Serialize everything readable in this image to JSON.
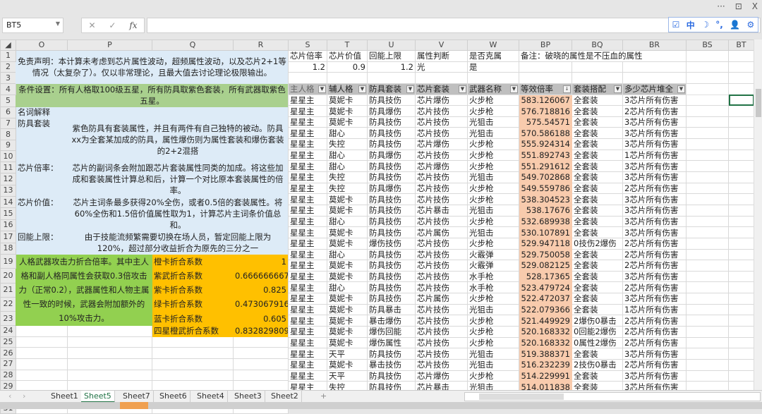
{
  "window": {
    "more": "···",
    "restore": "⊡",
    "close": "X"
  },
  "formula_bar": {
    "name_box": "BT5",
    "cancel": "✕",
    "confirm": "✓",
    "fx": "fx",
    "value": "",
    "ime_icons": [
      "☑",
      "中",
      "☽",
      "°,",
      "👤",
      "⚙"
    ]
  },
  "columns": [
    "O",
    "P",
    "Q",
    "R",
    "S",
    "T",
    "U",
    "V",
    "W",
    "BP",
    "BQ",
    "BR",
    "BS",
    "BT"
  ],
  "left": {
    "disclaimer": "免责声明：本计算未考虑到芯片属性波动，超频属性波动，以及芯片2+1等情况（太复杂了）。仅以非常理论，且最大值去讨论理论极限输出。",
    "conditions": "条件设置：所有人格取100级五星，所有防具取紫色套装，所有武器取紫色五星。",
    "glossary_label": "名词解释",
    "armor_label": "防具套装",
    "armor_text": "紫色防具有套装属性，并且有两件有自己独特的被动。防具xx为全套某加成的防具，属性爆伤则为属性套装和爆伤套装的2+2混搭",
    "chip_rate_label": "芯片倍率：",
    "chip_rate_text": "芯片的副词条会附加跟芯片套装属性同类的加成。将这些加成和套装属性计算总和后，计算一个对比原本套装属性的倍率。",
    "chip_value_label": "芯片价值：",
    "chip_value_text": "芯片主词条最多获得20%全伤，或者0.5倍的套装属性。将60%全伤和1.5倍价值属性取为1，计算芯片主词条价值总和。",
    "energy_label": "回能上限：",
    "energy_text": "由于技能流频繁需要切换在场人员，暂定回能上限为120%，超过部分收益折合为原先的三分之一",
    "weapon_text": "人格武器攻击力折合倍率。其中主人格和副人格同属性会获取0.3倍攻击力（正常0.2），武器属性和人物主属性一致的时候，武器会附加额外的10%攻击力。",
    "coefficients": [
      [
        "橙卡折合系数",
        "1"
      ],
      [
        "紫武折合系数",
        "0.666666667"
      ],
      [
        "紫卡折合系数",
        "0.825"
      ],
      [
        "绿卡折合系数",
        "0.473067916"
      ],
      [
        "蓝卡折合系数",
        "0.605"
      ],
      [
        "四星橙武折合系数",
        "0.832829809"
      ]
    ]
  },
  "params": {
    "headers": [
      "芯片倍率",
      "芯片价值",
      "回能上限",
      "属性判断",
      "是否克属"
    ],
    "values": [
      "1.2",
      "0.9",
      "1.2",
      "光",
      "是"
    ],
    "note": "备注：破晓的属性是不压血的属性"
  },
  "table": {
    "headers": [
      "主人格",
      "辅人格",
      "防具套装",
      "芯片套装",
      "武器名称",
      "等效倍率",
      "套装搭配",
      "多少芯片堆全"
    ],
    "rows": [
      [
        "星星主",
        "莫妮卡",
        "防具技伤",
        "芯片爆伤",
        "火步枪",
        "583.126067",
        "全套装",
        "3芯片所有伤害"
      ],
      [
        "星星主",
        "莫妮卡",
        "防具爆伤",
        "芯片技伤",
        "火步枪",
        "576.718816",
        "全套装",
        "2芯片所有伤害"
      ],
      [
        "星星主",
        "莫妮卡",
        "防具技伤",
        "芯片技伤",
        "光狙击",
        "575.54571",
        "全套装",
        "3芯片所有伤害"
      ],
      [
        "星星主",
        "甜心",
        "防具技伤",
        "芯片技伤",
        "光狙击",
        "570.586188",
        "全套装",
        "3芯片所有伤害"
      ],
      [
        "星星主",
        "失控",
        "防具技伤",
        "芯片爆伤",
        "火步枪",
        "555.924314",
        "全套装",
        "3芯片所有伤害"
      ],
      [
        "星星主",
        "甜心",
        "防具爆伤",
        "芯片技伤",
        "火步枪",
        "551.892743",
        "全套装",
        "1芯片所有伤害"
      ],
      [
        "星星主",
        "甜心",
        "防具技伤",
        "芯片爆伤",
        "火步枪",
        "551.291612",
        "全套装",
        "3芯片所有伤害"
      ],
      [
        "星星主",
        "失控",
        "防具技伤",
        "芯片技伤",
        "光狙击",
        "549.702868",
        "全套装",
        "3芯片所有伤害"
      ],
      [
        "星星主",
        "失控",
        "防具爆伤",
        "芯片技伤",
        "火步枪",
        "549.559786",
        "全套装",
        "2芯片所有伤害"
      ],
      [
        "星星主",
        "莫妮卡",
        "防具技伤",
        "芯片技伤",
        "火步枪",
        "538.304523",
        "全套装",
        "3芯片所有伤害"
      ],
      [
        "星星主",
        "莫妮卡",
        "防具技伤",
        "芯片暴击",
        "光狙击",
        "538.17676",
        "全套装",
        "3芯片所有伤害"
      ],
      [
        "星星主",
        "甜心",
        "防具技伤",
        "芯片技伤",
        "火步枪",
        "532.689938",
        "全套装",
        "3芯片所有伤害"
      ],
      [
        "星星主",
        "莫妮卡",
        "防具技伤",
        "芯片属伤",
        "光狙击",
        "530.107891",
        "全套装",
        "3芯片所有伤害"
      ],
      [
        "星星主",
        "莫妮卡",
        "爆伤技伤",
        "芯片技伤",
        "火步枪",
        "529.947118",
        "0技伤2爆伤",
        "2芯片所有伤害"
      ],
      [
        "星星主",
        "甜心",
        "防具技伤",
        "芯片技伤",
        "火霰弹",
        "529.750058",
        "全套装",
        "2芯片所有伤害"
      ],
      [
        "星星主",
        "莫妮卡",
        "防具技伤",
        "芯片技伤",
        "火霰弹",
        "529.082125",
        "全套装",
        "2芯片所有伤害"
      ],
      [
        "星星主",
        "莫妮卡",
        "防具技伤",
        "芯片技伤",
        "水手枪",
        "528.17365",
        "全套装",
        "3芯片所有伤害"
      ],
      [
        "星星主",
        "甜心",
        "防具技伤",
        "芯片技伤",
        "水手枪",
        "523.479724",
        "全套装",
        "2芯片所有伤害"
      ],
      [
        "星星主",
        "莫妮卡",
        "防具技伤",
        "芯片属伤",
        "火步枪",
        "522.472037",
        "全套装",
        "3芯片所有伤害"
      ],
      [
        "星星主",
        "莫妮卡",
        "防具暴击",
        "芯片技伤",
        "光狙击",
        "522.079366",
        "全套装",
        "1芯片所有伤害"
      ],
      [
        "星星主",
        "莫妮卡",
        "暴击爆伤",
        "芯片技伤",
        "火步枪",
        "521.449929",
        "2爆伤0暴击",
        "2芯片所有伤害"
      ],
      [
        "星星主",
        "莫妮卡",
        "爆伤回能",
        "芯片技伤",
        "火步枪",
        "520.168332",
        "0回能2爆伤",
        "2芯片所有伤害"
      ],
      [
        "星星主",
        "莫妮卡",
        "爆伤属性",
        "芯片技伤",
        "火步枪",
        "520.168332",
        "0属性2爆伤",
        "2芯片所有伤害"
      ],
      [
        "星星主",
        "天平",
        "防具技伤",
        "芯片技伤",
        "光狙击",
        "519.388371",
        "全套装",
        "3芯片所有伤害"
      ],
      [
        "星星主",
        "莫妮卡",
        "暴击技伤",
        "芯片技伤",
        "光狙击",
        "516.232239",
        "2技伤0暴击",
        "2芯片所有伤害"
      ],
      [
        "星星主",
        "天平",
        "防具技伤",
        "芯片爆伤",
        "火步枪",
        "514.229991",
        "全套装",
        "3芯片所有伤害"
      ],
      [
        "星星主",
        "失控",
        "防具技伤",
        "芯片暴击",
        "光狙击",
        "514.011838",
        "全套装",
        "3芯片所有伤害"
      ]
    ]
  },
  "sheet_tabs": [
    "Sheet1",
    "Sheet5",
    "Sheet7",
    "Sheet6",
    "Sheet4",
    "Sheet3",
    "Sheet2"
  ],
  "active_tab": "Sheet5",
  "add_sheet": "+",
  "colors": {
    "light_blue": "#ddebf7",
    "green": "#a9d08e",
    "bright_green": "#92d050",
    "orange": "#ffc000",
    "peach": "#f8cbad",
    "header_gray": "#bfbfbf",
    "accent": "#217346"
  }
}
